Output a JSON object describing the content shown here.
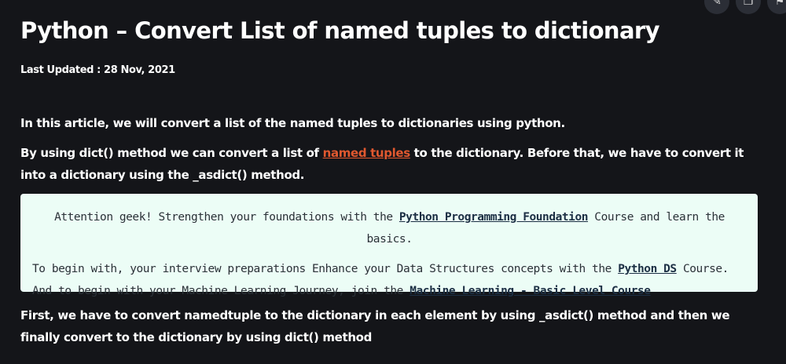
{
  "toolbar": {
    "actions": [
      {
        "icon": "pencil-icon",
        "glyph": "✎"
      },
      {
        "icon": "copy-icon",
        "glyph": "❐"
      },
      {
        "icon": "bookmark-icon",
        "glyph": "⚑"
      }
    ]
  },
  "article": {
    "title": "Python – Convert List of named tuples to dictionary",
    "last_updated": "Last Updated : 28 Nov, 2021",
    "intro": "In this article, we will convert a list of the named tuples to dictionaries using python.",
    "para2_before": "By using dict() method we can convert a list of ",
    "para2_link": "named tuples",
    "para2_after": " to the dictionary. Before that, we have to convert it into a dictionary using the _asdict() method.",
    "para3": "First, we have to convert namedtuple to the dictionary in each element by using _asdict() method and then we finally convert to the dictionary by using dict() method"
  },
  "notice": {
    "line1_before": "Attention geek! Strengthen your foundations with the ",
    "line1_link": "Python Programming Foundation",
    "line1_after": " Course and learn the basics.",
    "line2_before": "To begin with, your interview preparations Enhance your Data Structures concepts with the ",
    "line2_link1": "Python DS",
    "line2_mid": " Course. And to begin with your Machine Learning Journey, join the ",
    "line2_link2": "Machine Learning - Basic Level Course"
  },
  "colors": {
    "background": "#141519",
    "link": "#e0582f",
    "notice_bg": "#ecfdf6"
  }
}
